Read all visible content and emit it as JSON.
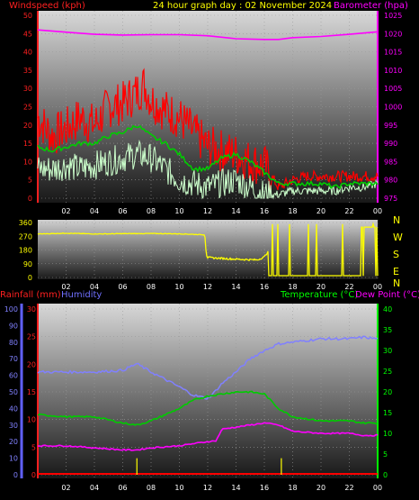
{
  "header": {
    "left_label": "Windspeed (kph)",
    "title": "24 hour graph day : 02 November 2024",
    "right_label": "Barometer (hpa)"
  },
  "colors": {
    "wind_label": "#ff2020",
    "title": "#ffff00",
    "baro_label": "#ff00ff",
    "dir_label": "#ffff00",
    "rain_label": "#ff2020",
    "humidity_label": "#7070ff",
    "temp_label": "#00ff00",
    "dew_label": "#ff00ff",
    "gust": "#ff0000",
    "wind": "#ccffcc",
    "wind_avg": "#00cc00",
    "baro": "#ff00ff",
    "direction": "#ffff00",
    "humidity": "#8080ff",
    "temperature": "#00cc00",
    "dew_point": "#ff00ff",
    "rain": "#ff0000",
    "rain_rate": "#ffff00"
  },
  "panel2": {
    "compass": [
      "N",
      "W",
      "S",
      "E",
      "N"
    ]
  },
  "panel3": {
    "rain_label": "Rainfall (mm)",
    "humidity_label": "Humidity",
    "temp_label": "Temperature (°C)",
    "dew_label": "Dew Point (°C)"
  },
  "chart_data": [
    {
      "type": "line",
      "title": "24 hour graph day : 02 November 2024",
      "x_ticks": [
        "02",
        "04",
        "06",
        "08",
        "10",
        "12",
        "14",
        "16",
        "18",
        "20",
        "22",
        "00"
      ],
      "y_left": {
        "label": "Windspeed (kph)",
        "range": [
          0,
          50
        ],
        "ticks": [
          0,
          5,
          10,
          15,
          20,
          25,
          30,
          35,
          40,
          45,
          50
        ]
      },
      "y_right": {
        "label": "Barometer (hpa)",
        "range": [
          975,
          1025
        ],
        "ticks": [
          975,
          980,
          985,
          990,
          995,
          1000,
          1005,
          1010,
          1015,
          1020,
          1025
        ]
      },
      "grid": true,
      "series": [
        {
          "name": "Gust",
          "axis": "left",
          "x": [
            0,
            1,
            2,
            3,
            4,
            5,
            6,
            7,
            7.5,
            8,
            9,
            10,
            11,
            12,
            13,
            14,
            15,
            16,
            16.5,
            17,
            18,
            19,
            20,
            21,
            22,
            23,
            24
          ],
          "y": [
            22,
            17,
            19,
            22,
            20,
            25,
            26,
            29,
            31,
            27,
            24,
            22,
            18,
            14,
            13,
            12,
            10,
            9,
            6,
            3,
            5,
            6,
            6,
            6,
            6,
            6,
            6
          ]
        },
        {
          "name": "Wind Speed",
          "axis": "left",
          "x": [
            0,
            1,
            2,
            3,
            4,
            5,
            6,
            7,
            8,
            9,
            10,
            11,
            12,
            13,
            14,
            15,
            16,
            17,
            18,
            19,
            20,
            21,
            22,
            23,
            24
          ],
          "y": [
            8,
            8,
            9,
            8,
            9,
            10,
            11,
            12,
            11,
            8,
            5,
            4,
            3,
            4,
            5,
            3,
            1,
            1,
            2,
            2,
            2,
            2,
            3,
            3,
            4
          ]
        },
        {
          "name": "Average Wind",
          "axis": "left",
          "x": [
            0,
            1,
            2,
            3,
            4,
            5,
            6,
            7,
            8,
            9,
            10,
            11,
            12,
            13,
            14,
            15,
            16,
            17,
            18,
            19,
            20,
            21,
            22,
            23,
            24
          ],
          "y": [
            14,
            13,
            14,
            15,
            15,
            17,
            18,
            20,
            17,
            15,
            12,
            8,
            8,
            11,
            12,
            10,
            7,
            4,
            4,
            4,
            4,
            3,
            4,
            4,
            4
          ]
        },
        {
          "name": "Barometer",
          "axis": "right",
          "x": [
            0,
            2,
            4,
            6,
            8,
            10,
            12,
            14,
            16,
            17,
            18,
            20,
            22,
            24
          ],
          "y": [
            1021,
            1020.4,
            1019.8,
            1019.6,
            1019.7,
            1019.7,
            1019.4,
            1018.6,
            1018.4,
            1018.4,
            1018.9,
            1019.2,
            1019.8,
            1020.5
          ]
        }
      ]
    },
    {
      "type": "line",
      "x_ticks": [
        "02",
        "04",
        "06",
        "08",
        "10",
        "12",
        "14",
        "16",
        "18",
        "20",
        "22",
        "00"
      ],
      "y": {
        "range": [
          0,
          360
        ],
        "ticks": [
          0,
          90,
          180,
          270,
          360
        ]
      },
      "series": [
        {
          "name": "Wind Direction",
          "x": [
            0,
            2,
            4,
            6,
            8,
            10,
            11.8,
            11.9,
            12,
            14,
            15.5,
            16,
            16.4,
            16.6,
            17,
            17.2,
            17.5,
            18,
            20,
            22,
            23,
            24
          ],
          "y": [
            285,
            290,
            285,
            287,
            288,
            286,
            280,
            150,
            130,
            120,
            115,
            135,
            190,
            300,
            320,
            10,
            320,
            20,
            15,
            20,
            330,
            340
          ]
        }
      ]
    },
    {
      "type": "line",
      "x_ticks": [
        "02",
        "04",
        "06",
        "08",
        "10",
        "12",
        "14",
        "16",
        "18",
        "20",
        "22",
        "00"
      ],
      "y_left": {
        "label": "Rainfall (mm)",
        "range": [
          0,
          30
        ],
        "ticks": [
          0,
          5,
          10,
          15,
          20,
          25,
          30
        ]
      },
      "y_humidity": {
        "label": "Humidity",
        "range": [
          0,
          100
        ],
        "ticks": [
          0,
          10,
          20,
          30,
          40,
          50,
          60,
          70,
          80,
          90,
          100
        ]
      },
      "y_right": {
        "label": "Temperature (°C)",
        "range": [
          0,
          40
        ],
        "ticks": [
          0,
          5,
          10,
          15,
          20,
          25,
          30,
          35,
          40
        ]
      },
      "grid": true,
      "series": [
        {
          "name": "Humidity",
          "axis": "humidity",
          "x": [
            0,
            2,
            4,
            6,
            7,
            8,
            10,
            11,
            12,
            12.5,
            13,
            14,
            15,
            16,
            17,
            18,
            20,
            22,
            23,
            24
          ],
          "y": [
            62,
            62,
            62,
            63,
            67,
            62,
            53,
            48,
            46,
            50,
            55,
            62,
            70,
            75,
            79,
            80,
            82,
            82,
            83,
            82
          ]
        },
        {
          "name": "Temperature",
          "axis": "right",
          "x": [
            0,
            2,
            4,
            6,
            7,
            8,
            10,
            11,
            12,
            13,
            14,
            15,
            16,
            17,
            18,
            20,
            22,
            23,
            24
          ],
          "y": [
            14.5,
            14,
            14,
            12.5,
            12,
            13,
            16,
            18,
            19,
            19.5,
            20,
            20,
            19.5,
            16,
            14,
            13,
            13,
            12.5,
            12.5
          ]
        },
        {
          "name": "Dew Point",
          "axis": "right",
          "x": [
            0,
            2,
            4,
            6,
            7,
            8,
            10,
            11,
            12,
            12.6,
            13,
            14,
            15,
            16,
            17,
            18,
            20,
            22,
            23,
            24
          ],
          "y": [
            7,
            7,
            6.5,
            6,
            6,
            6.5,
            7,
            7.5,
            8,
            8.2,
            11,
            11.5,
            12,
            12.5,
            12,
            10.5,
            10,
            10,
            9.5,
            9.5
          ]
        },
        {
          "name": "Rainfall",
          "axis": "left",
          "x": [
            0,
            24
          ],
          "y": [
            0,
            0
          ]
        },
        {
          "name": "Rain Rate",
          "axis": "left",
          "x": [
            7,
            17.2
          ],
          "y": [
            3,
            3
          ]
        }
      ]
    }
  ]
}
